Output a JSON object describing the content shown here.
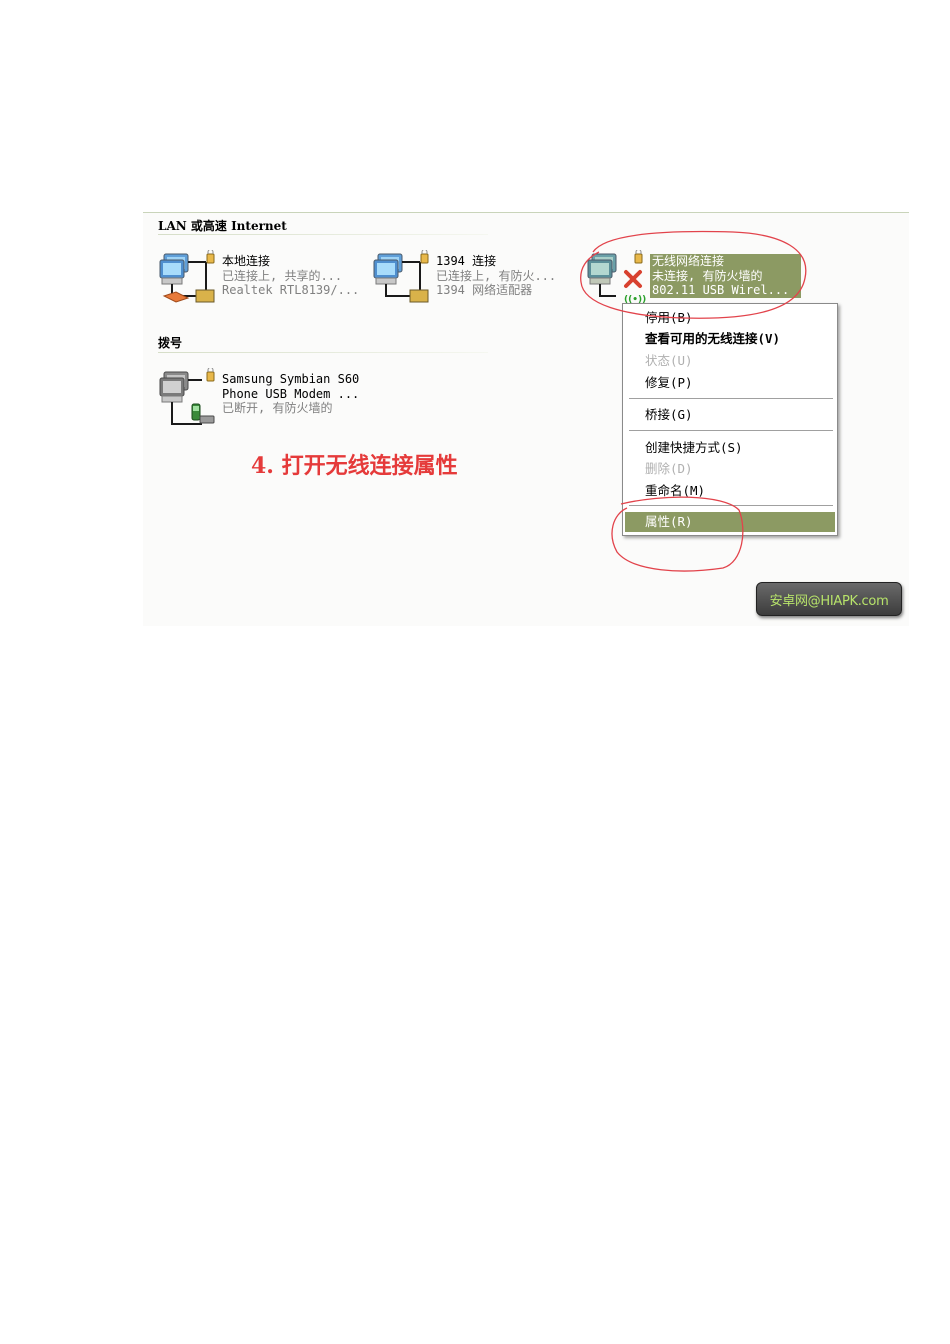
{
  "groups": {
    "lan_title": "LAN 或高速 Internet",
    "dialup_title": "拨号"
  },
  "connections": [
    {
      "name": "本地连接",
      "status": "已连接上, 共享的...",
      "device": "Realtek RTL8139/...",
      "icon": "network-computers-icon"
    },
    {
      "name": "1394 连接",
      "status": "已连接上, 有防火...",
      "device": "1394 网络适配器",
      "icon": "network-computers-icon"
    },
    {
      "name": "无线网络连接",
      "status": "未连接, 有防火墙的",
      "device": "802.11 USB Wirel...",
      "icon": "wireless-network-disconnected-icon"
    },
    {
      "name": "Samsung Symbian S60",
      "status": "Phone USB Modem ...",
      "device": "已断开, 有防火墙的",
      "icon": "phone-modem-icon"
    }
  ],
  "context_menu": {
    "items": [
      {
        "label": "停用(B)"
      },
      {
        "label": "查看可用的无线连接(V)",
        "bold": true
      },
      {
        "label": "状态(U)",
        "disabled": true
      },
      {
        "label": "修复(P)"
      },
      {
        "label": "桥接(G)"
      },
      {
        "label": "创建快捷方式(S)"
      },
      {
        "label": "删除(D)",
        "disabled": true
      },
      {
        "label": "重命名(M)"
      },
      {
        "label": "属性(R)",
        "active": true
      }
    ]
  },
  "callout": "4. 打开无线连接属性",
  "watermark": "安卓网@HIAPK.com",
  "colors": {
    "selection": "#8c9a63",
    "callout": "#e53a3a",
    "annotation": "#e2434b",
    "watermark_text": "#b7e36a"
  }
}
